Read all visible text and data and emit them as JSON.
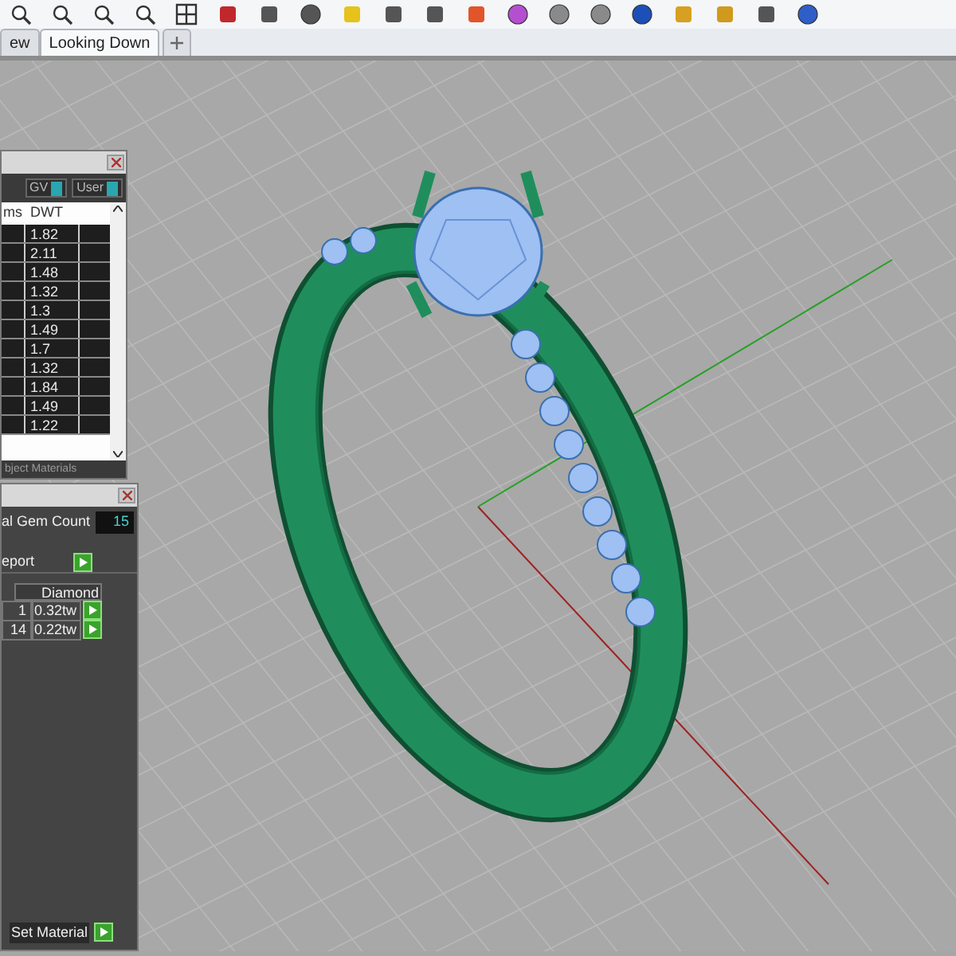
{
  "viewport_tabs": [
    {
      "label": "ew",
      "selected": false
    },
    {
      "label": "Looking Down",
      "selected": true
    }
  ],
  "gem_panel": {
    "toggles": [
      {
        "label": "GV",
        "on": true
      },
      {
        "label": "User",
        "on": true
      }
    ],
    "columns": [
      "ms",
      "DWT"
    ],
    "rows": [
      "1.82",
      "2.11",
      "1.48",
      "1.32",
      "1.3",
      "1.49",
      "1.7",
      "1.32",
      "1.84",
      "1.49",
      "1.22"
    ],
    "bottom_tab": "bject Materials"
  },
  "count_panel": {
    "label": "al Gem Count",
    "count": "15",
    "report_label": "eport",
    "table_header": "Diamond",
    "rows": [
      {
        "column_1": "1",
        "column_2": "0.32tw"
      },
      {
        "column_1": "14",
        "column_2": "0.22tw"
      }
    ],
    "set_material": "Set Material"
  }
}
